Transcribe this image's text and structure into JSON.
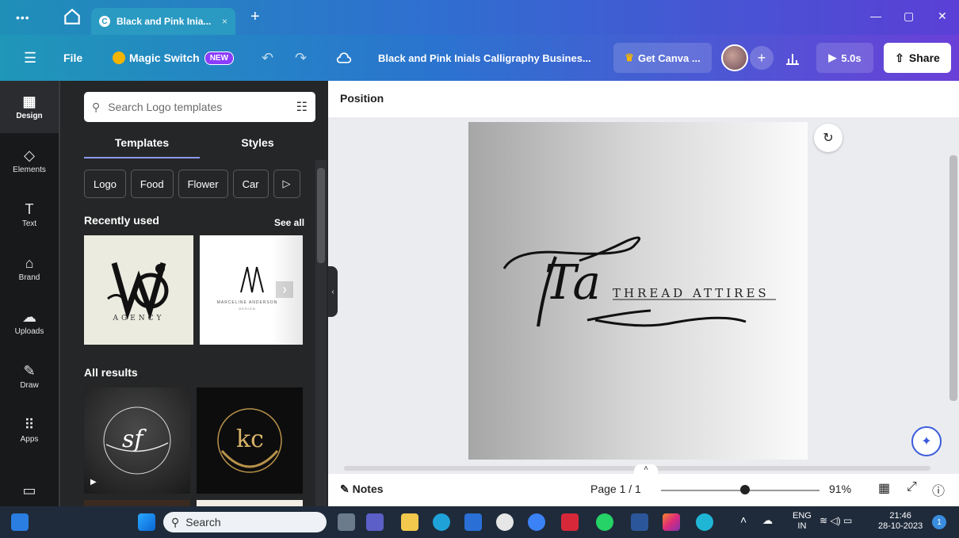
{
  "browser": {
    "more_label": "•••",
    "tab_title": "Black and Pink Inia...",
    "tab_close": "×",
    "new_tab": "+",
    "win_minimize": "—",
    "win_restore": "▢",
    "win_close": "✕"
  },
  "topbar": {
    "menu_icon": "☰",
    "file_label": "File",
    "magic_switch_label": "Magic Switch",
    "new_badge": "NEW",
    "undo": "↶",
    "redo": "↷",
    "doc_title": "Black and Pink Inials Calligraphy Busines...",
    "get_canva_label": "Get Canva ...",
    "plus": "+",
    "play_label": "5.0s",
    "share_label": "Share"
  },
  "rail": {
    "items": [
      {
        "label": "Design",
        "icon": "▦"
      },
      {
        "label": "Elements",
        "icon": "◇"
      },
      {
        "label": "Text",
        "icon": "T"
      },
      {
        "label": "Brand",
        "icon": "⌂"
      },
      {
        "label": "Uploads",
        "icon": "☁"
      },
      {
        "label": "Draw",
        "icon": "✎"
      },
      {
        "label": "Apps",
        "icon": "⠿"
      }
    ]
  },
  "panel": {
    "search_placeholder": "Search Logo templates",
    "tabs": [
      "Templates",
      "Styles"
    ],
    "chips": [
      "Logo",
      "Food",
      "Flower",
      "Car",
      "▷"
    ],
    "recently_used": "Recently used",
    "see_all": "See all",
    "all_results": "All results",
    "thumb_texts": {
      "agency": "AGENCY",
      "marceline": "MARCELINE ANDERSON",
      "design": "DESIGN",
      "sf": "sf",
      "kc": "kc"
    }
  },
  "editor": {
    "position_label": "Position",
    "canvas_brand": "THREAD ATTIRES",
    "canvas_monogram": "Ta",
    "notes_label": "Notes",
    "page_label": "Page 1 / 1",
    "zoom": "91%",
    "zoom_fraction": 0.5
  },
  "taskbar": {
    "search_label": "Search",
    "lang": "ENG",
    "region": "IN",
    "time": "21:46",
    "date": "28-10-2023",
    "notif_count": "1"
  }
}
